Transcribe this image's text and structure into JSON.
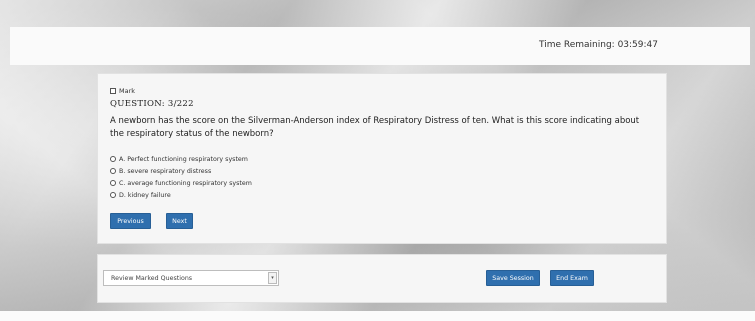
{
  "header": {
    "time_remaining": "Time Remaining: 03:59:47"
  },
  "question": {
    "mark_label": "Mark",
    "number_label": "QUESTION: 3/222",
    "text": "A newborn has the score on the Silverman-Anderson index of Respiratory Distress of ten. What is this score indicating about the respiratory status of the newborn?",
    "options": [
      "A. Perfect functioning respiratory system",
      "B. severe respiratory distress",
      "C. average functioning respiratory system",
      "D. kidney failure"
    ]
  },
  "navigation": {
    "previous_label": "Previous",
    "next_label": "Next"
  },
  "footer": {
    "review_select_value": "Review Marked Questions",
    "save_session_label": "Save Session",
    "end_exam_label": "End Exam"
  },
  "colors": {
    "primary_button": "#2f6fae",
    "card_background": "#f6f6f6"
  }
}
